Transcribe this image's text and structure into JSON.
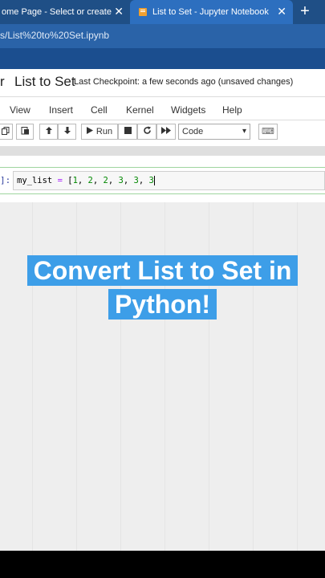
{
  "browser": {
    "tabs": [
      {
        "label": "ome Page - Select or create a n",
        "active": false
      },
      {
        "label": "List to Set - Jupyter Notebook",
        "active": true
      }
    ],
    "close_glyph": "✕",
    "new_tab_glyph": "+",
    "url": "s/List%20to%20Set.ipynb"
  },
  "notebook": {
    "logo_fragment": "r",
    "title": "List to Set",
    "checkpoint": "Last Checkpoint: a few seconds ago  (unsaved changes)",
    "menu": [
      "View",
      "Insert",
      "Cell",
      "Kernel",
      "Widgets",
      "Help"
    ],
    "toolbar": {
      "run_label": "Run",
      "cell_type": "Code",
      "keyboard_glyph": "⌨"
    },
    "cell": {
      "prompt": "]:",
      "code_var": "my_list",
      "code_op": " = ",
      "code_open": "[",
      "code_values": [
        "1",
        "2",
        "2",
        "3",
        "3",
        "3"
      ]
    }
  },
  "caption": {
    "line1": "Convert List to Set in",
    "line2": "Python!"
  },
  "colors": {
    "tabbar": "#1f4f86",
    "active_tab": "#2d6fbf",
    "caption_bg": "#3d9ee8",
    "cell_border": "#9fd59f"
  }
}
